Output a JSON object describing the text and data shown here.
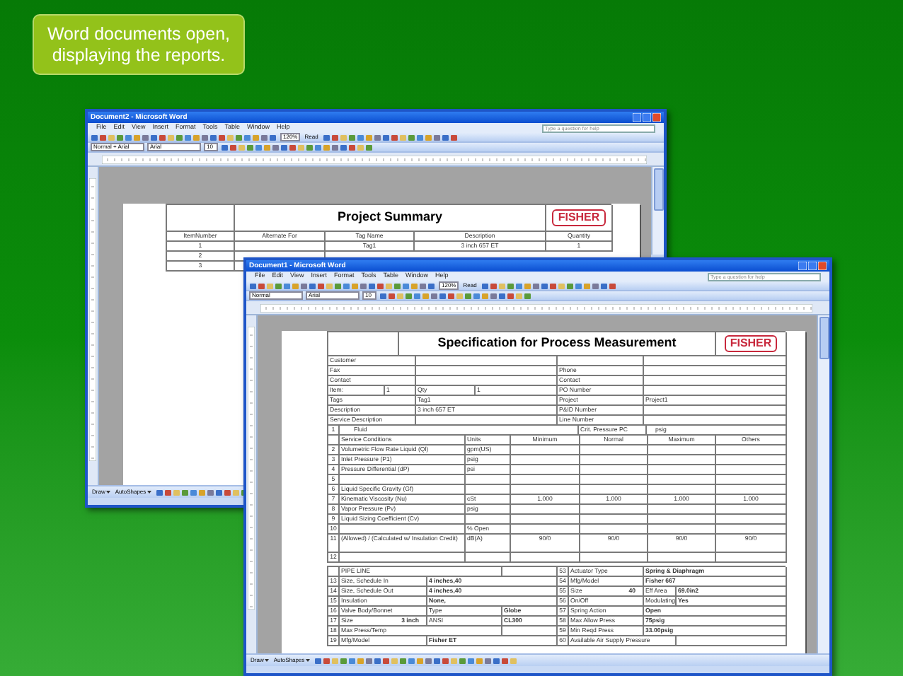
{
  "caption": "Word documents open, displaying the reports.",
  "windows": [
    {
      "title": "Document2 - Microsoft Word",
      "menu": [
        "File",
        "Edit",
        "View",
        "Insert",
        "Format",
        "Tools",
        "Table",
        "Window",
        "Help"
      ],
      "help_placeholder": "Type a question for help",
      "zoom": "120%",
      "read": "Read",
      "style": "Normal + Arial",
      "font": "Arial",
      "size": "10",
      "draw": "Draw",
      "autoshapes": "AutoShapes",
      "document": {
        "kind": "summary",
        "title": "Project Summary",
        "logo": "FISHER",
        "columns": [
          "ItemNumber",
          "Alternate For",
          "Tag Name",
          "Description",
          "Quantity"
        ],
        "rows": [
          {
            "item_number": "1",
            "tag_name": "Tag1",
            "description": "3 inch 657 ET",
            "quantity": "1"
          },
          {
            "item_number": "2"
          },
          {
            "item_number": "3"
          }
        ]
      }
    },
    {
      "title": "Document1 - Microsoft Word",
      "menu": [
        "File",
        "Edit",
        "View",
        "Insert",
        "Format",
        "Tools",
        "Table",
        "Window",
        "Help"
      ],
      "help_placeholder": "Type a question for help",
      "zoom": "120%",
      "read": "Read",
      "style": "Normal",
      "font": "Arial",
      "size": "10",
      "draw": "Draw",
      "autoshapes": "AutoShapes",
      "document": {
        "kind": "spec",
        "title": "Specification for Process Measurement",
        "logo": "FISHER",
        "info": [
          {
            "label": "Customer"
          },
          {
            "label": "Fax",
            "label_2": "Phone"
          },
          {
            "label": "Contact",
            "label_2": "Contact"
          },
          {
            "kind": "item",
            "label": "Item:",
            "value": "1",
            "qty_label": "Qty",
            "qty": "1",
            "label_2": "PO Number"
          },
          {
            "label": "Tags",
            "value": "Tag1",
            "label_2": "Project",
            "value_2": "Project1"
          },
          {
            "label": "Description",
            "value": "3 inch 657 ET",
            "label_2": "P&ID Number"
          },
          {
            "label": "Service Description",
            "label_2": "Line Number"
          }
        ],
        "fluid": {
          "number": "1",
          "label": "Fluid",
          "crit_label": "Crit. Pressure PC",
          "crit_unit": "psig"
        },
        "columns": [
          "Service Conditions",
          "Units",
          "Minimum",
          "Normal",
          "Maximum",
          "Others"
        ],
        "conditions": [
          {
            "number": "2",
            "label": "Volumetric Flow Rate Liquid (Ql)",
            "unit": "gpm(US)"
          },
          {
            "number": "3",
            "label": "Inlet Pressure (P1)",
            "unit": "psig"
          },
          {
            "number": "4",
            "label": "Pressure Differential (dP)",
            "unit": "psi"
          },
          {
            "number": "5"
          },
          {
            "number": "6",
            "label": "Liquid Specific Gravity (Gf)"
          },
          {
            "number": "7",
            "label": "Kinematic Viscosity (Nu)",
            "unit": "cSt",
            "values": [
              "1.000",
              "1.000",
              "1.000",
              "1.000"
            ]
          },
          {
            "number": "8",
            "label": "Vapor Pressure (Pv)",
            "unit": "psig"
          },
          {
            "number": "9",
            "label": "Liquid Sizing Coefficient (Cv)"
          },
          {
            "number": "10",
            "unit": "% Open"
          },
          {
            "number": "11",
            "label": "(Allowed) / (Calculated w/ Insulation Credit)",
            "unit": "dB(A)",
            "values": [
              "90/0",
              "90/0",
              "90/0",
              "90/0"
            ]
          },
          {
            "number": "12"
          }
        ],
        "pipe": [
          {
            "label": "PIPE LINE"
          },
          {
            "number": "13",
            "label": "Size, Schedule In",
            "value": "4 inches,40"
          },
          {
            "number": "14",
            "label": "Size, Schedule Out",
            "value": "4 inches,40"
          },
          {
            "number": "15",
            "label": "Insulation",
            "value": "None,"
          },
          {
            "number": "16",
            "label": "Valve Body/Bonnet",
            "sub_label": "Type",
            "value": "Globe"
          },
          {
            "number": "17",
            "label": "Size",
            "label_value": "3 inch",
            "sub_label": "ANSI",
            "value": "CL300"
          },
          {
            "number": "18",
            "label": "Max Press/Temp"
          },
          {
            "number": "19",
            "label": "Mfg/Model",
            "value": "Fisher ET"
          }
        ],
        "actuator": [
          {
            "number": "53",
            "label": "Actuator Type",
            "value": "Spring & Diaphragm"
          },
          {
            "number": "54",
            "label": "Mfg/Model",
            "value": "Fisher 667"
          },
          {
            "number": "55",
            "label": "Size",
            "label_value": "40",
            "sub_label": "Eff Area",
            "value": "69.0in2"
          },
          {
            "number": "56",
            "label": "On/Off",
            "sub_label": "Modulating",
            "value": "Yes"
          },
          {
            "number": "57",
            "label": "Spring Action",
            "value": "Open"
          },
          {
            "number": "58",
            "label": "Max Allow Press",
            "value": "75psig"
          },
          {
            "number": "59",
            "label": "Min Reqd Press",
            "value": "33.00psig"
          },
          {
            "number": "60",
            "label": "Available Air Supply Pressure"
          }
        ]
      }
    }
  ]
}
